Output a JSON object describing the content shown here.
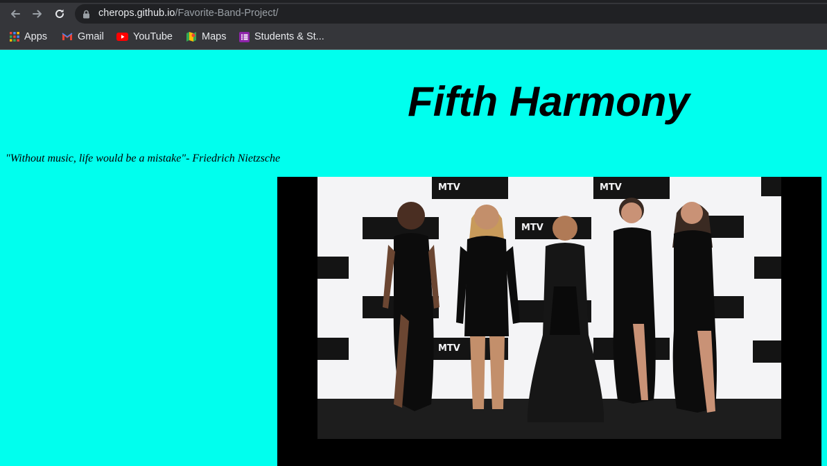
{
  "browser": {
    "url_host": "cherops.github.io",
    "url_path": "/Favorite-Band-Project/",
    "bookmarks": [
      {
        "label": "Apps",
        "icon": "apps-grid-icon"
      },
      {
        "label": "Gmail",
        "icon": "gmail-icon"
      },
      {
        "label": "YouTube",
        "icon": "youtube-icon"
      },
      {
        "label": "Maps",
        "icon": "maps-icon"
      },
      {
        "label": "Students & St...",
        "icon": "list-icon"
      }
    ]
  },
  "page": {
    "title": "Fifth Harmony",
    "quote": "\"Without music, life would be a mistake\"- Friedrich Nietzsche",
    "background_color": "#00ffee",
    "photo_logo_text": "MTV"
  }
}
